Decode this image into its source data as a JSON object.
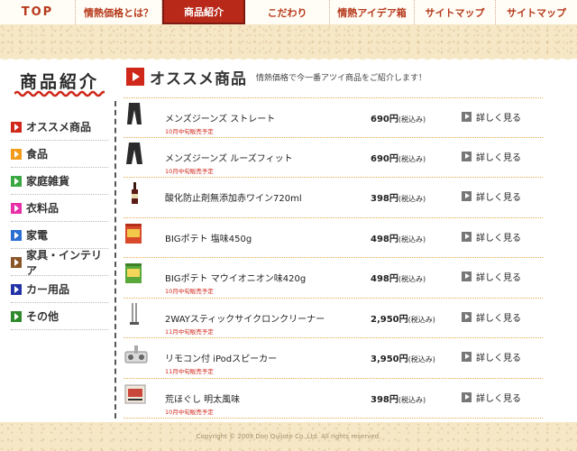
{
  "nav": {
    "items": [
      {
        "label": "TOP",
        "width": 84
      },
      {
        "label": "情熱価格とは？",
        "width": 96
      },
      {
        "label": "商品紹介",
        "width": 92,
        "active": true
      },
      {
        "label": "こだわり",
        "width": 94
      },
      {
        "label": "情熱アイデア箱",
        "width": 94
      },
      {
        "label": "サイトマップ",
        "width": 90
      },
      {
        "label": "サイトマップ",
        "width": 90
      }
    ]
  },
  "sidebar": {
    "title": "商品紹介",
    "items": [
      {
        "label": "オススメ商品",
        "color": "#d0271b"
      },
      {
        "label": "食品",
        "color": "#f29b1b"
      },
      {
        "label": "家庭雑貨",
        "color": "#3aa742"
      },
      {
        "label": "衣料品",
        "color": "#e72fa7"
      },
      {
        "label": "家電",
        "color": "#2a6fd1"
      },
      {
        "label": "家具・インテリア",
        "color": "#8a5527"
      },
      {
        "label": "カー用品",
        "color": "#2233a8"
      },
      {
        "label": "その他",
        "color": "#2f8a2b"
      }
    ]
  },
  "main": {
    "title": "オススメ商品",
    "subtitle": "情熱価格で今一番アツイ商品をご紹介します！"
  },
  "products": [
    {
      "name": "メンズジーンズ ストレート",
      "note": "10月中旬販売予定",
      "price": "690円",
      "tax": "(税込み)",
      "button": "詳しく見る",
      "thumb": "jeans-icon"
    },
    {
      "name": "メンズジーンズ ルーズフィット",
      "note": "10月中旬販売予定",
      "price": "690円",
      "tax": "(税込み)",
      "button": "詳しく見る",
      "thumb": "jeans-icon"
    },
    {
      "name": "酸化防止剤無添加赤ワイン720ml",
      "note": "",
      "price": "398円",
      "tax": "(税込み)",
      "button": "詳しく見る",
      "thumb": "wine-bottle-icon"
    },
    {
      "name": "BIGポテト 塩味450g",
      "note": "",
      "price": "498円",
      "tax": "(税込み)",
      "button": "詳しく見る",
      "thumb": "chips-bag-icon"
    },
    {
      "name": "BIGポテト マウイオニオン味420g",
      "note": "10月中旬販売予定",
      "price": "498円",
      "tax": "(税込み)",
      "button": "詳しく見る",
      "thumb": "chips-bag-icon"
    },
    {
      "name": "2WAYスティックサイクロンクリーナー",
      "note": "11月中旬販売予定",
      "price": "2,950円",
      "tax": "(税込み)",
      "button": "詳しく見る",
      "thumb": "stick-cleaner-icon"
    },
    {
      "name": "リモコン付 iPodスピーカー",
      "note": "11月中旬販売予定",
      "price": "3,950円",
      "tax": "(税込み)",
      "button": "詳しく見る",
      "thumb": "speaker-icon"
    },
    {
      "name": "荒ほぐし 明太風味",
      "note": "10月中旬販売予定",
      "price": "398円",
      "tax": "(税込み)",
      "button": "詳しく見る",
      "thumb": "food-pack-icon"
    }
  ],
  "footer": {
    "copyright": "Copyright © 2009 Don Quijote Co.,Ltd. All rights reserved."
  }
}
